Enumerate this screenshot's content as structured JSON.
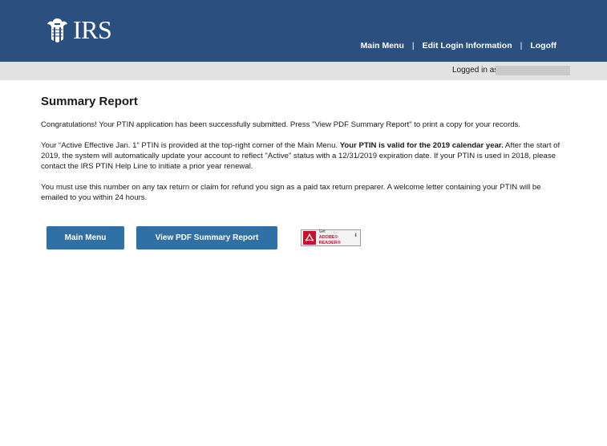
{
  "header": {
    "logo_text": "IRS",
    "nav": {
      "main_menu": "Main Menu",
      "separator": "|",
      "edit_login": "Edit Login Information",
      "logoff": "Logoff"
    },
    "background_color": "#2b4f7e"
  },
  "login_bar": {
    "label": "Logged in as"
  },
  "main": {
    "title": "Summary Report",
    "para1": "Congratulations! Your PTIN application has been successfully submitted. Press \"View PDF Summary Report\" to print a copy for your records.",
    "para2_part1": "Your “Active Effective Jan. 1” PTIN is provided at the top-right corner of the Main Menu. ",
    "para2_bold": "Your PTIN is valid for the 2019 calendar year.",
    "para2_part2": " After the start of 2019, the system will automatically update your account to reflect \"Active\" status with a 12/31/2019 expiration date. If your PTIN is used in 2018, please contact the IRS PTIN Help Line to initiate a prior year renewal.",
    "para3": "You must use this number on any tax return or claim for refund you sign as a paid tax return preparer. A welcome letter containing your PTIN will be emailed to you within 24 hours."
  },
  "buttons": {
    "main_menu": "Main Menu",
    "view_pdf": "View PDF Summary Report",
    "button_color": "#2f71a6"
  },
  "adobe_badge": {
    "get": "Get",
    "name": "ADOBE® READER®",
    "icon": "adobe-reader-icon"
  }
}
